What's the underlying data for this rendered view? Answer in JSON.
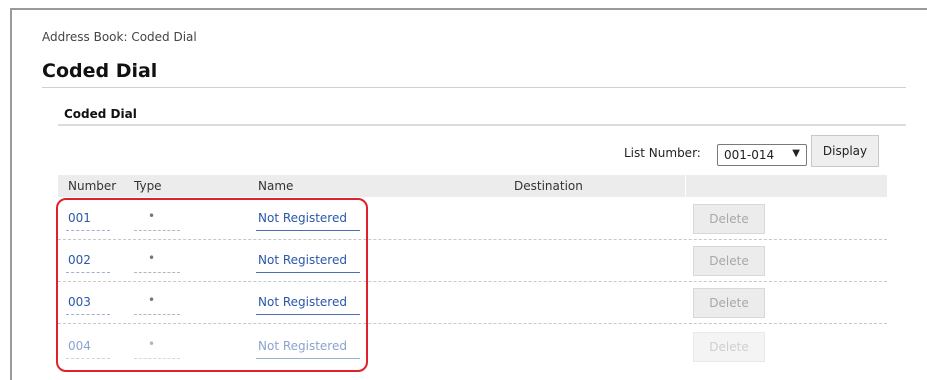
{
  "breadcrumb": "Address Book: Coded Dial",
  "page_title": "Coded Dial",
  "section_title": "Coded Dial",
  "list_number": {
    "label": "List Number:",
    "selected": "001-014",
    "display_button": "Display"
  },
  "table": {
    "headers": {
      "number": "Number",
      "type": "Type",
      "name": "Name",
      "destination": "Destination"
    },
    "rows": [
      {
        "number": "001",
        "type": "•",
        "name": "Not Registered",
        "action": "Delete"
      },
      {
        "number": "002",
        "type": "•",
        "name": "Not Registered",
        "action": "Delete"
      },
      {
        "number": "003",
        "type": "•",
        "name": "Not Registered",
        "action": "Delete"
      },
      {
        "number": "004",
        "type": "•",
        "name": "Not Registered",
        "action": "Delete"
      }
    ]
  },
  "colors": {
    "highlight": "#e0202a",
    "link": "#2a57a8"
  }
}
